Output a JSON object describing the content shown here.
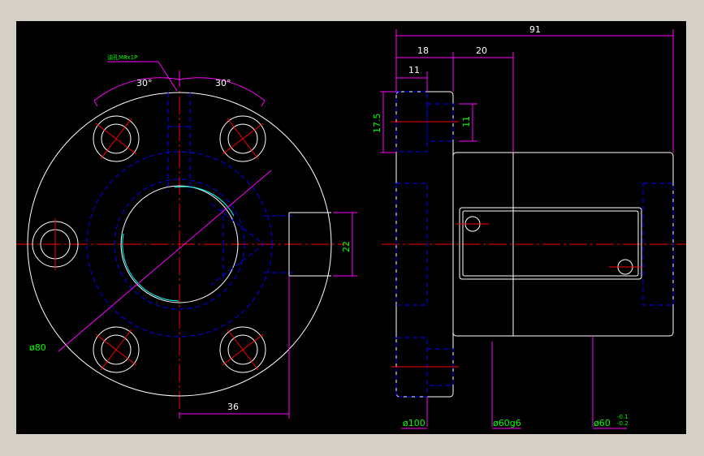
{
  "colors": {
    "background": "#000000",
    "frame": "#d4d0c8",
    "outline": "#ffffff",
    "center_line": "#ff0000",
    "hidden_line": "#0000ff",
    "dimension": "#ff00ff",
    "dimension_text": "#00ff00",
    "thread": "#00ffff"
  },
  "front_view": {
    "oil_hole_note": "油孔M8x1P",
    "angle_left": "30°",
    "angle_right": "30°",
    "dim_22": "22",
    "dim_36": "36",
    "dim_pcd": "ø80"
  },
  "side_view": {
    "dim_91": "91",
    "dim_18": "18",
    "dim_20": "20",
    "dim_11_top": "11",
    "dim_17_5": "17.5",
    "dim_11_right": "11",
    "dim_d100": "ø100",
    "dim_d60g6": "ø60g6",
    "dim_d60": "ø60",
    "tol_upper": "-0.1",
    "tol_lower": "-0.2"
  }
}
